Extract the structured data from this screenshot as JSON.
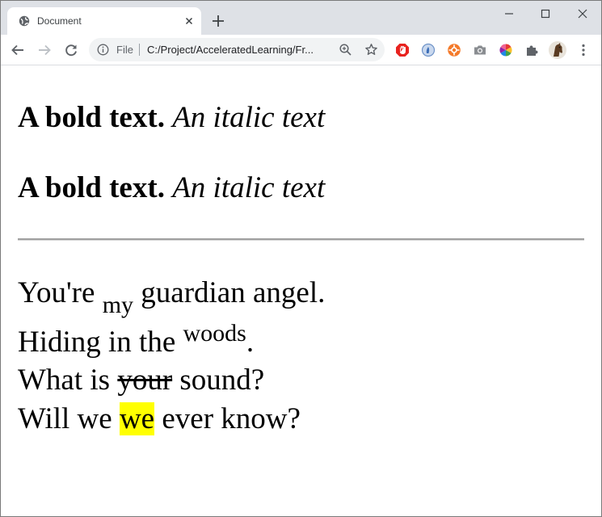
{
  "tab": {
    "title": "Document",
    "favicon": "globe-icon",
    "close_icon": "close-icon"
  },
  "window_controls": [
    "minimize-icon",
    "maximize-icon",
    "close-icon"
  ],
  "toolbar": {
    "back_icon": "back-arrow-icon",
    "forward_icon": "forward-arrow-icon",
    "reload_icon": "reload-icon",
    "scheme_label": "File",
    "url": "C:/Project/AcceleratedLearning/Fr...",
    "extensions": [
      "adblock-icon",
      "extension-blue-icon",
      "extension-orange-icon",
      "camera-icon",
      "color-wheel-icon",
      "puzzle-icon"
    ],
    "menu_icon": "kebab-menu-icon"
  },
  "page": {
    "heading_1": {
      "bold": "A bold text",
      "sep": ". ",
      "italic": "An italic text"
    },
    "heading_2": {
      "bold": "A bold text",
      "sep": ". ",
      "italic": "An italic text"
    },
    "poem": {
      "line1": {
        "before": "You're ",
        "sub": "my",
        "after": " guardian angel."
      },
      "line2": {
        "before": "Hiding in the ",
        "sup": "woods",
        "after": "."
      },
      "line3": {
        "before": "What is ",
        "strike": "your",
        "after": " sound?"
      },
      "line4": {
        "before": "Will we ",
        "mark": "we",
        "after": " ever know?"
      }
    }
  },
  "colors": {
    "tabstrip": "#dee1e6",
    "highlight": "#ffff00",
    "rule": "#a0a0a0"
  }
}
